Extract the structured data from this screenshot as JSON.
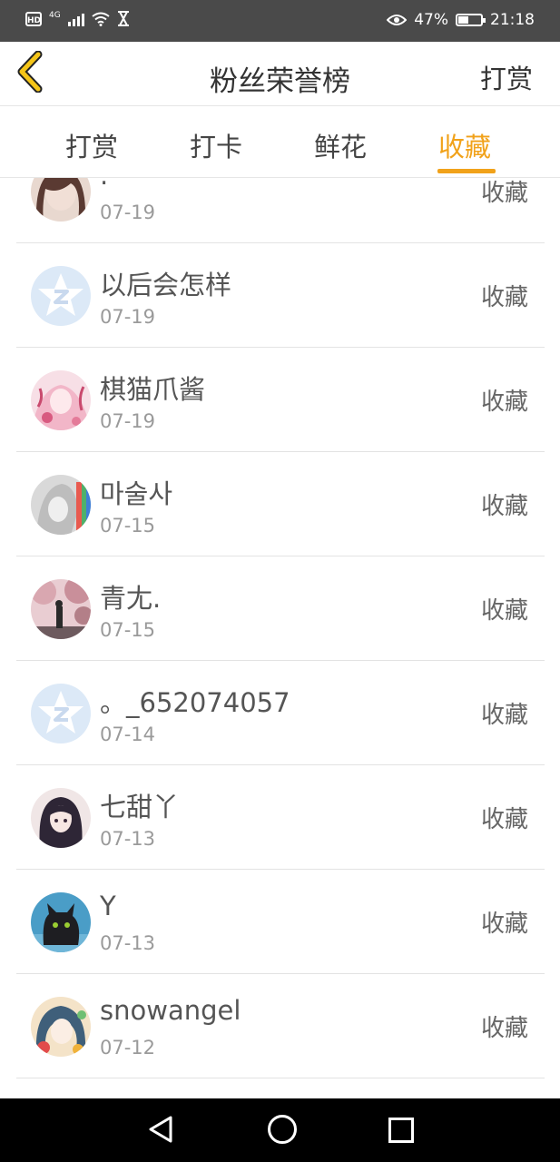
{
  "status_bar": {
    "hd": "HD",
    "network": "4G",
    "battery_percent": "47%",
    "battery_level": 0.47,
    "time": "21:18"
  },
  "header": {
    "title": "粉丝荣誉榜",
    "action": "打赏"
  },
  "tabs": [
    {
      "label": "打赏",
      "active": false
    },
    {
      "label": "打卡",
      "active": false
    },
    {
      "label": "鲜花",
      "active": false
    },
    {
      "label": "收藏",
      "active": true
    }
  ],
  "accent_color": "#f1a21a",
  "list": [
    {
      "name": ".",
      "date": "07-19",
      "action": "收藏",
      "avatar": "photo-girl"
    },
    {
      "name": "以后会怎样",
      "date": "07-19",
      "action": "收藏",
      "avatar": "default-star"
    },
    {
      "name": "棋猫爪酱",
      "date": "07-19",
      "action": "收藏",
      "avatar": "anime-pink"
    },
    {
      "name": "마술사",
      "date": "07-15",
      "action": "收藏",
      "avatar": "sketch-rainbow"
    },
    {
      "name": "青尢.",
      "date": "07-15",
      "action": "收藏",
      "avatar": "cherry-blossom"
    },
    {
      "name": "。_652074057",
      "date": "07-14",
      "action": "收藏",
      "avatar": "default-star"
    },
    {
      "name": "七甜丫",
      "date": "07-13",
      "action": "收藏",
      "avatar": "anime-girl-dark"
    },
    {
      "name": "Y",
      "date": "07-13",
      "action": "收藏",
      "avatar": "black-cat"
    },
    {
      "name": "snowangel",
      "date": "07-12",
      "action": "收藏",
      "avatar": "anime-colorful"
    }
  ]
}
